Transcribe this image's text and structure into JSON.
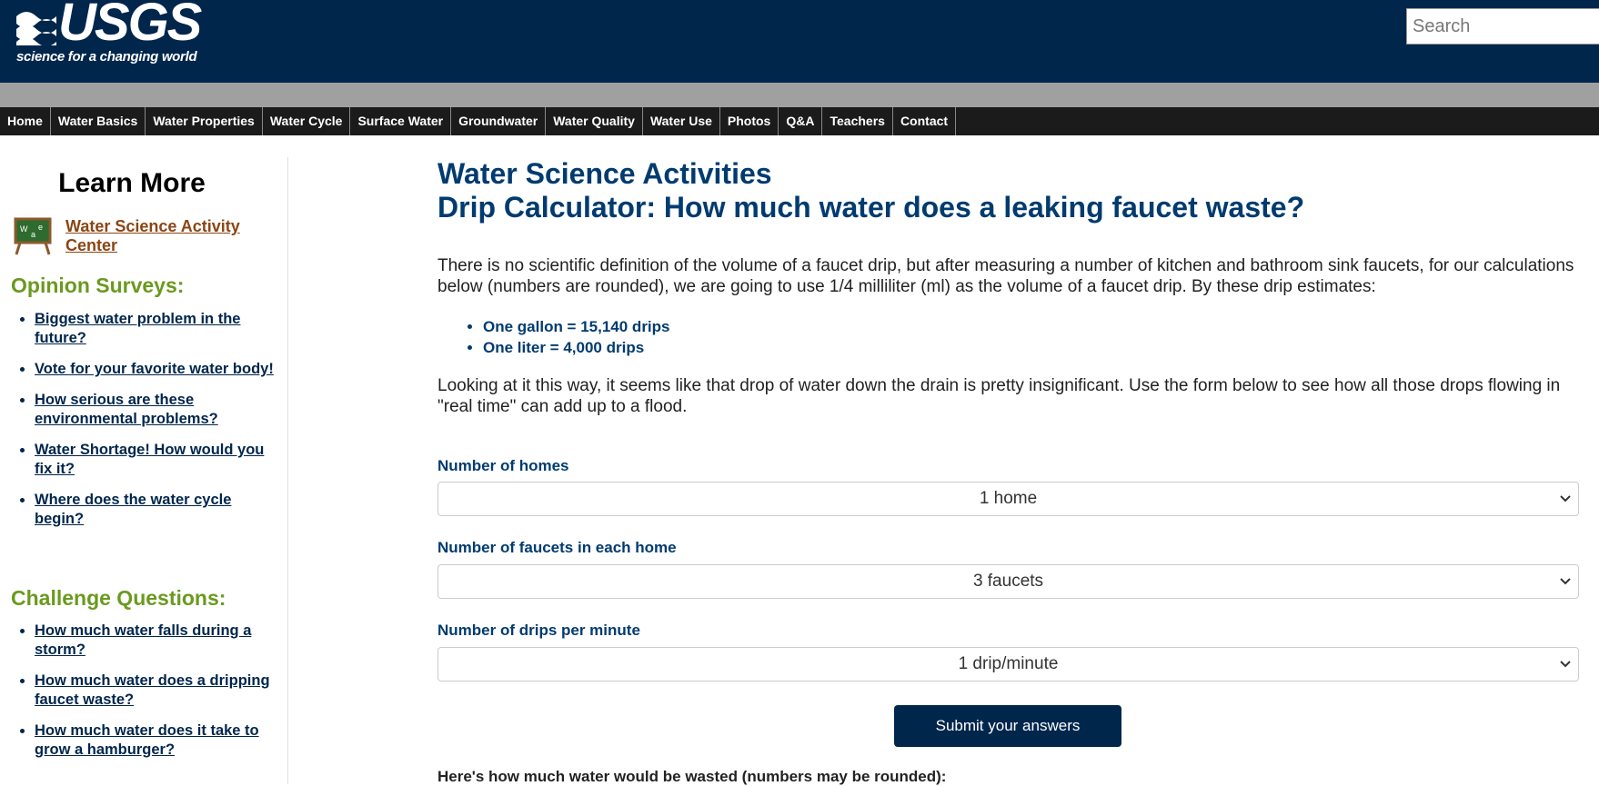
{
  "header": {
    "logo_text": "USGS",
    "tagline": "science for a changing world",
    "search_placeholder": "Search"
  },
  "nav": [
    "Home",
    "Water Basics",
    "Water Properties",
    "Water Cycle",
    "Surface Water",
    "Groundwater",
    "Water Quality",
    "Water Use",
    "Photos",
    "Q&A",
    "Teachers",
    "Contact"
  ],
  "sidebar": {
    "learn_more": "Learn More",
    "activity_link": "Water Science Activity Center",
    "surveys_heading": "Opinion Surveys:",
    "surveys": [
      "Biggest water problem in the future?",
      "Vote for your favorite water body!",
      "How serious are these environmental problems?",
      "Water Shortage! How would you fix it?",
      "Where does the water cycle begin?"
    ],
    "challenge_heading": "Challenge Questions:",
    "challenges": [
      "How much water falls during a storm?",
      "How much water does a dripping faucet waste?",
      "How much water does it take to grow a hamburger?"
    ]
  },
  "main": {
    "title1": "Water Science Activities",
    "title2": "Drip Calculator: How much water does a leaking faucet waste?",
    "intro": "There is no scientific definition of the volume of a faucet drip, but after measuring a number of kitchen and bathroom sink faucets, for our calculations below (numbers are rounded), we are going to use 1/4 milliliter (ml) as the volume of a faucet drip. By these drip estimates:",
    "bullets": [
      "One gallon = 15,140 drips",
      "One liter = 4,000 drips"
    ],
    "para2": "Looking at it this way, it seems like that drop of water down the drain is pretty insignificant. Use the form below to see how all those drops flowing in \"real time\" can add up to a flood.",
    "form": {
      "homes_label": "Number of homes",
      "homes_value": "1 home",
      "faucets_label": "Number of faucets in each home",
      "faucets_value": "3 faucets",
      "drips_label": "Number of drips per minute",
      "drips_value": "1 drip/minute",
      "submit": "Submit your answers"
    },
    "result_text": "Here's how much water would be wasted (numbers may be rounded):"
  }
}
